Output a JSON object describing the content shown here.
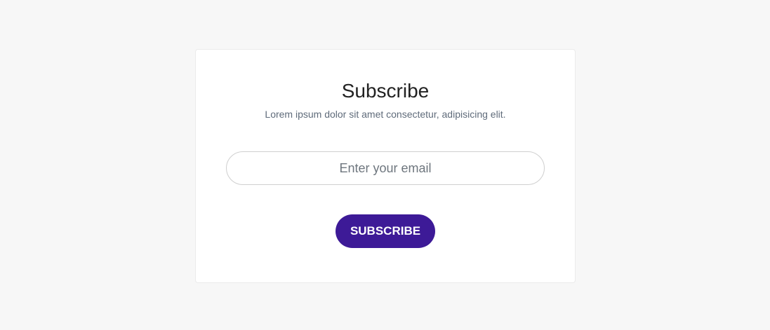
{
  "subscribe": {
    "title": "Subscribe",
    "subtitle": "Lorem ipsum dolor sit amet consectetur, adipisicing elit.",
    "email_placeholder": "Enter your email",
    "email_value": "",
    "button_label": "SUBSCRIBE"
  },
  "colors": {
    "page_background": "#f7f7f7",
    "card_background": "#ffffff",
    "button_background": "#3d1a97",
    "button_text": "#ffffff",
    "title_text": "#222222",
    "subtitle_text": "#5f6b7a"
  }
}
